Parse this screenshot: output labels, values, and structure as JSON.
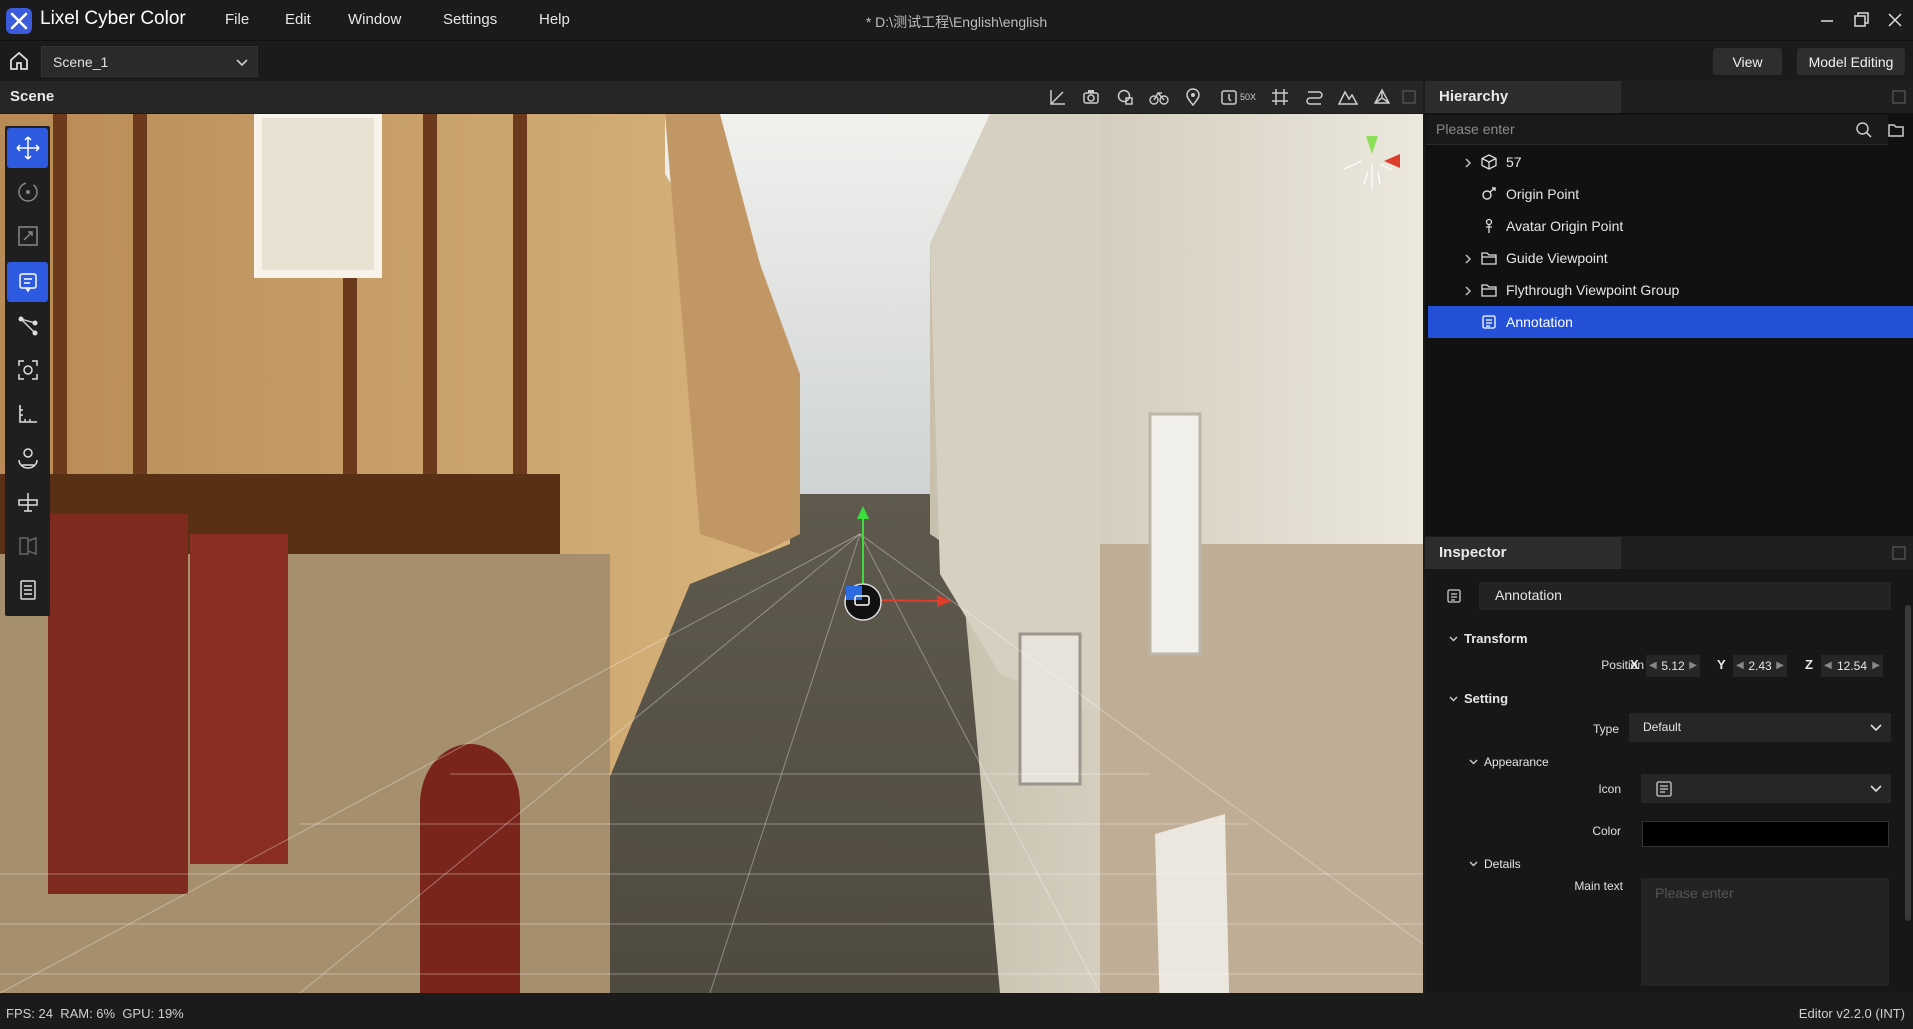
{
  "app": {
    "name": "Lixel Cyber Color",
    "document_title": "* D:\\测试工程\\English\\english",
    "menu": [
      "File",
      "Edit",
      "Window",
      "Settings",
      "Help"
    ]
  },
  "toolbar": {
    "scene_select": "Scene_1",
    "view_label": "View",
    "model_editing_label": "Model Editing",
    "speed_label": "50X"
  },
  "scene": {
    "title": "Scene"
  },
  "hierarchy": {
    "title": "Hierarchy",
    "search_placeholder": "Please enter",
    "items": [
      {
        "label": "57",
        "icon": "cube-icon",
        "expandable": true
      },
      {
        "label": "Origin Point",
        "icon": "origin-point-icon",
        "expandable": false
      },
      {
        "label": "Avatar Origin Point",
        "icon": "avatar-icon",
        "expandable": false
      },
      {
        "label": "Guide Viewpoint",
        "icon": "folder-icon",
        "expandable": true
      },
      {
        "label": "Flythrough Viewpoint Group",
        "icon": "folder-icon",
        "expandable": true
      },
      {
        "label": "Annotation",
        "icon": "annotation-icon",
        "expandable": false,
        "selected": true
      }
    ]
  },
  "inspector": {
    "title": "Inspector",
    "object_name": "Annotation",
    "transform": {
      "label": "Transform",
      "position_label": "Position",
      "x_label": "X",
      "x": "5.12",
      "y_label": "Y",
      "y": "2.43",
      "z_label": "Z",
      "z": "12.54"
    },
    "setting": {
      "label": "Setting",
      "type_label": "Type",
      "type_value": "Default",
      "appearance_label": "Appearance",
      "icon_label": "Icon",
      "color_label": "Color",
      "color_value": "#000000",
      "details_label": "Details",
      "main_text_label": "Main text",
      "main_text_placeholder": "Please enter"
    }
  },
  "status": {
    "stats": "FPS: 24  RAM: 6%  GPU: 19%",
    "version": "Editor v2.2.0 (INT)"
  },
  "colors": {
    "accent": "#2450d8",
    "background": "#1b1b1b"
  }
}
